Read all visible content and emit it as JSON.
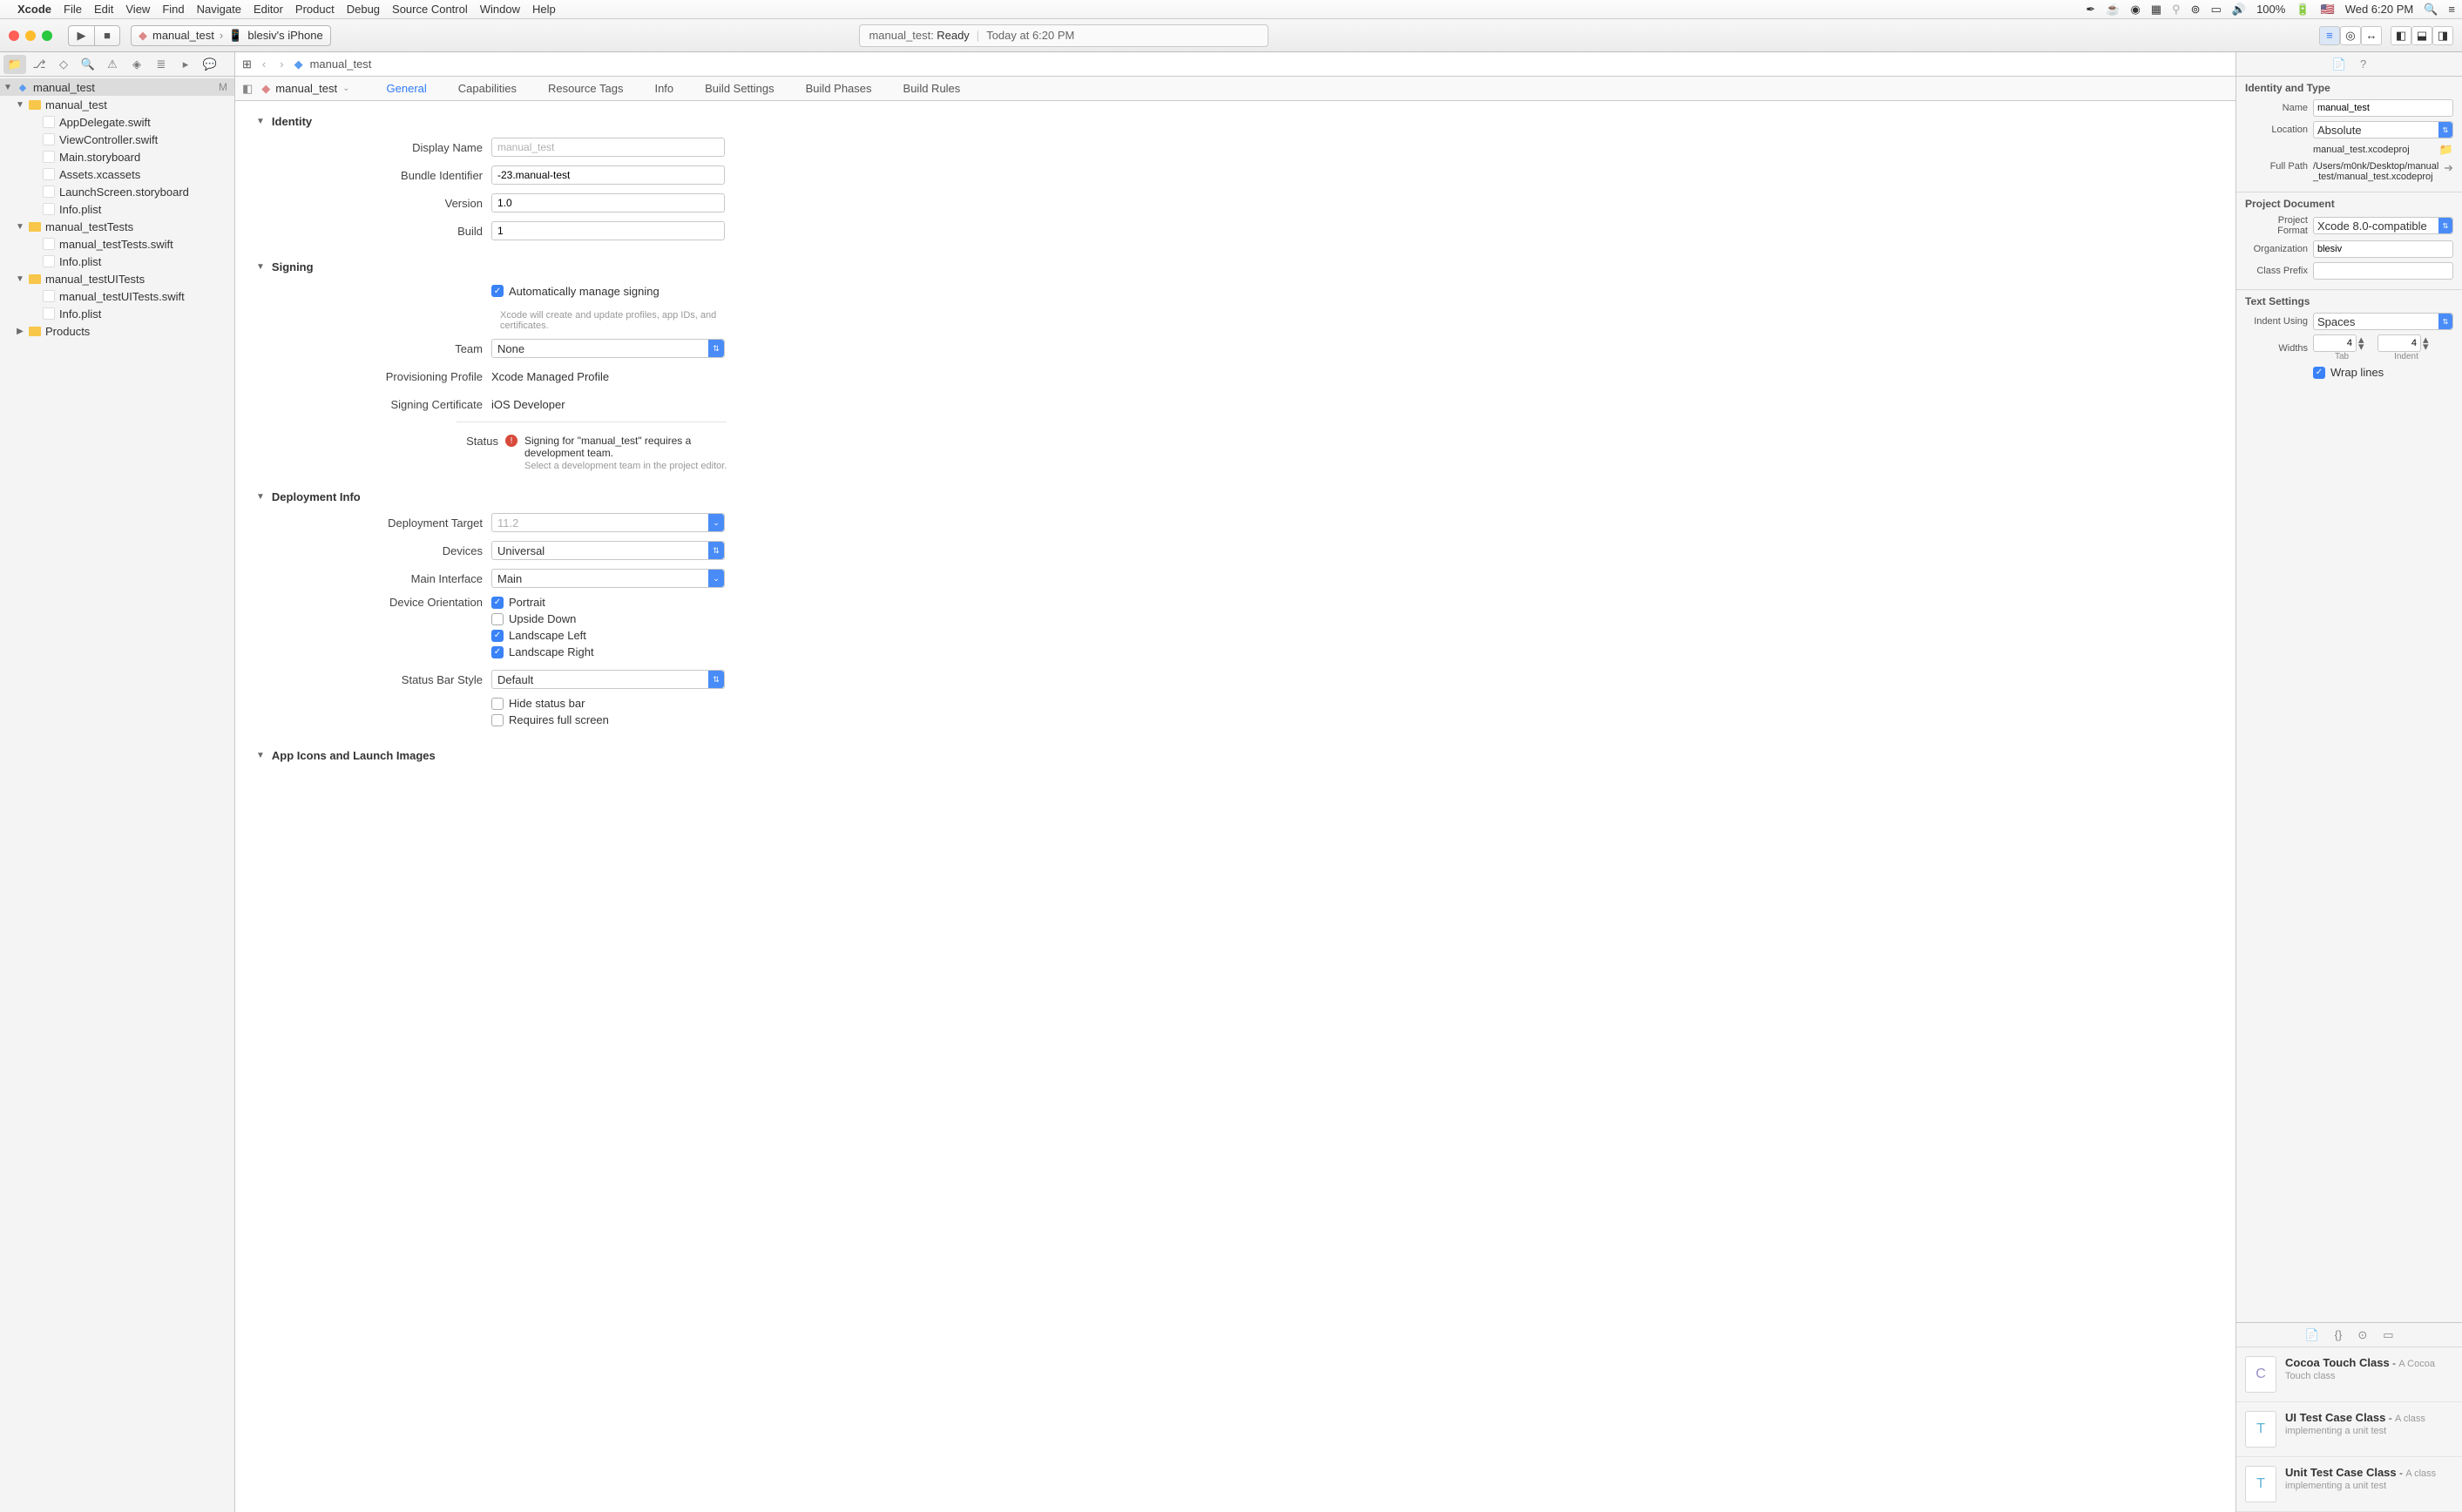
{
  "menubar": {
    "app": "Xcode",
    "items": [
      "File",
      "Edit",
      "View",
      "Find",
      "Navigate",
      "Editor",
      "Product",
      "Debug",
      "Source Control",
      "Window",
      "Help"
    ],
    "battery": "100%",
    "datetime": "Wed 6:20 PM"
  },
  "toolbar": {
    "scheme_target": "manual_test",
    "scheme_device": "blesiv's iPhone",
    "status_target": "manual_test:",
    "status_state": "Ready",
    "status_time": "Today at 6:20 PM"
  },
  "navigator": {
    "root": "manual_test",
    "root_badge": "M",
    "tree": [
      {
        "label": "manual_test",
        "type": "folder",
        "depth": 1,
        "children": [
          {
            "label": "AppDelegate.swift",
            "type": "swift"
          },
          {
            "label": "ViewController.swift",
            "type": "swift"
          },
          {
            "label": "Main.storyboard",
            "type": "file"
          },
          {
            "label": "Assets.xcassets",
            "type": "file"
          },
          {
            "label": "LaunchScreen.storyboard",
            "type": "file"
          },
          {
            "label": "Info.plist",
            "type": "file"
          }
        ]
      },
      {
        "label": "manual_testTests",
        "type": "folder",
        "children": [
          {
            "label": "manual_testTests.swift",
            "type": "swift"
          },
          {
            "label": "Info.plist",
            "type": "file"
          }
        ]
      },
      {
        "label": "manual_testUITests",
        "type": "folder",
        "children": [
          {
            "label": "manual_testUITests.swift",
            "type": "swift"
          },
          {
            "label": "Info.plist",
            "type": "file"
          }
        ]
      },
      {
        "label": "Products",
        "type": "folder",
        "collapsed": true
      }
    ]
  },
  "jumpbar": {
    "item": "manual_test"
  },
  "tabs": {
    "project": "manual_test",
    "items": [
      "General",
      "Capabilities",
      "Resource Tags",
      "Info",
      "Build Settings",
      "Build Phases",
      "Build Rules"
    ],
    "active": "General"
  },
  "identity": {
    "heading": "Identity",
    "display_name_label": "Display Name",
    "display_name_placeholder": "manual_test",
    "bundle_id_label": "Bundle Identifier",
    "bundle_id": "-23.manual-test",
    "version_label": "Version",
    "version": "1.0",
    "build_label": "Build",
    "build": "1"
  },
  "signing": {
    "heading": "Signing",
    "auto_label": "Automatically manage signing",
    "auto_desc": "Xcode will create and update profiles, app IDs, and certificates.",
    "team_label": "Team",
    "team": "None",
    "prov_label": "Provisioning Profile",
    "prov": "Xcode Managed Profile",
    "cert_label": "Signing Certificate",
    "cert": "iOS Developer",
    "status_label": "Status",
    "status_msg": "Signing for \"manual_test\" requires a development team.",
    "status_hint": "Select a development team in the project editor."
  },
  "deployment": {
    "heading": "Deployment Info",
    "target_label": "Deployment Target",
    "target_placeholder": "11.2",
    "devices_label": "Devices",
    "devices": "Universal",
    "main_if_label": "Main Interface",
    "main_if": "Main",
    "orient_label": "Device Orientation",
    "orient_portrait": "Portrait",
    "orient_upside": "Upside Down",
    "orient_left": "Landscape Left",
    "orient_right": "Landscape Right",
    "statusbar_label": "Status Bar Style",
    "statusbar": "Default",
    "hide_sb": "Hide status bar",
    "req_fs": "Requires full screen"
  },
  "appicons": {
    "heading": "App Icons and Launch Images"
  },
  "inspector": {
    "identity_heading": "Identity and Type",
    "name_label": "Name",
    "name": "manual_test",
    "location_label": "Location",
    "location": "Absolute",
    "location_file": "manual_test.xcodeproj",
    "fullpath_label": "Full Path",
    "fullpath": "/Users/m0nk/Desktop/manual_test/manual_test.xcodeproj",
    "projdoc_heading": "Project Document",
    "format_label": "Project Format",
    "format": "Xcode 8.0-compatible",
    "org_label": "Organization",
    "org": "blesiv",
    "prefix_label": "Class Prefix",
    "text_heading": "Text Settings",
    "indent_using_label": "Indent Using",
    "indent_using": "Spaces",
    "widths_label": "Widths",
    "tab_width": "4",
    "indent_width": "4",
    "tab_sublabel": "Tab",
    "indent_sublabel": "Indent",
    "wrap_label": "Wrap lines"
  },
  "library": [
    {
      "title": "Cocoa Touch Class",
      "sub": "A Cocoa Touch class",
      "glyph": "C",
      "color": "#9a8fc7"
    },
    {
      "title": "UI Test Case Class",
      "sub": "A class implementing a unit test",
      "glyph": "T",
      "color": "#5fb3d4"
    },
    {
      "title": "Unit Test Case Class",
      "sub": "A class implementing a unit test",
      "glyph": "T",
      "color": "#5fb3d4"
    }
  ]
}
